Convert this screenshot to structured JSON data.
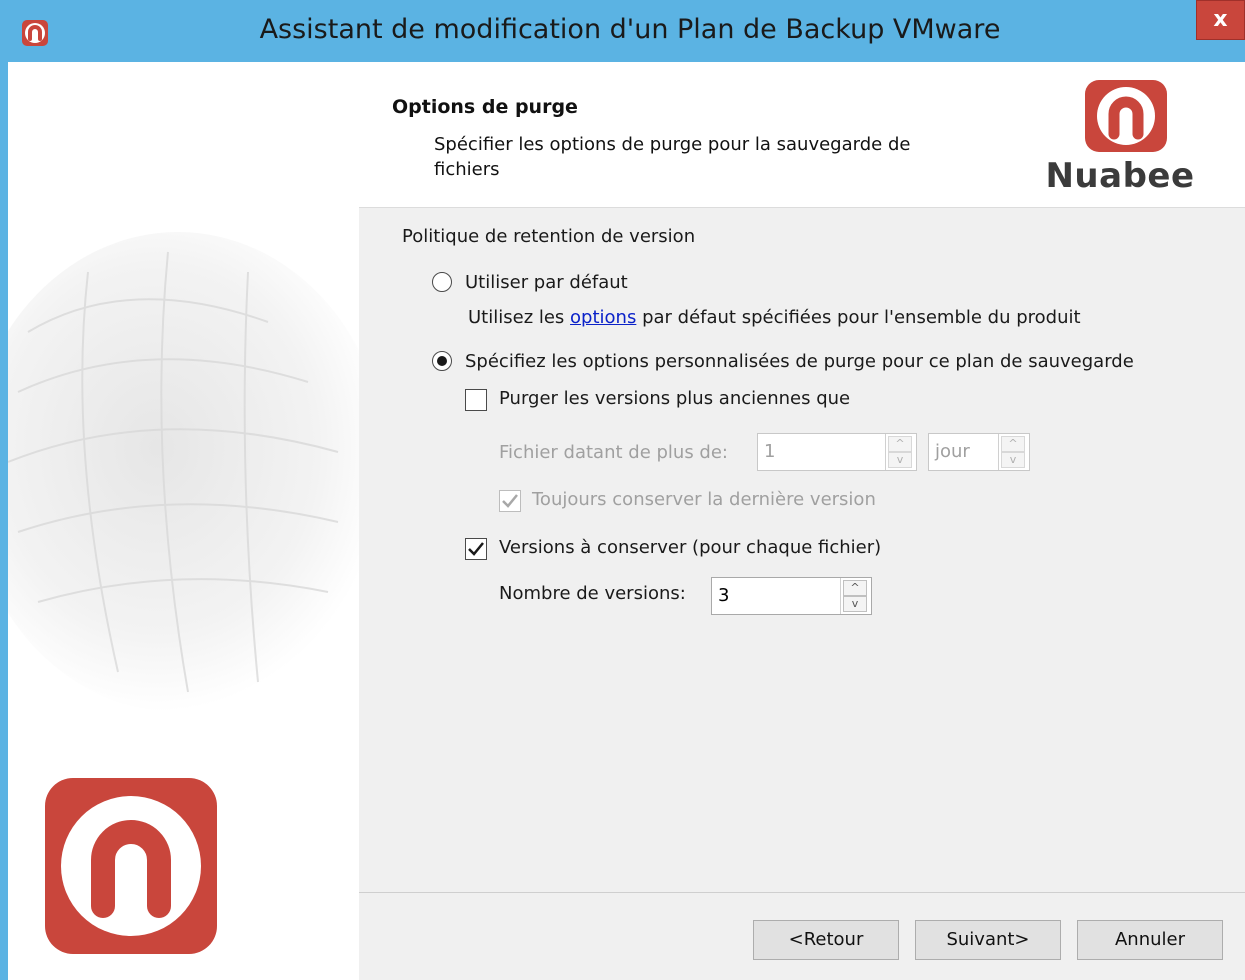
{
  "window": {
    "title": "Assistant de modification d'un Plan de Backup VMware",
    "close_label": "x",
    "accent_color": "#5bb3e3",
    "brand_color": "#c9463c"
  },
  "header": {
    "title": "Options de purge",
    "description": "Spécifier les options de purge pour la sauvegarde de fichiers",
    "brand_name": "Nuabee"
  },
  "retention": {
    "group_label": "Politique de retention de version",
    "default_option": {
      "label": "Utiliser par défaut",
      "desc_prefix": "Utilisez les ",
      "desc_link": "options",
      "desc_suffix": " par défaut spécifiées pour l'ensemble du produit",
      "selected": false
    },
    "custom_option": {
      "label": "Spécifiez les options personnalisées de purge pour ce plan de sauvegarde",
      "selected": true
    },
    "purge_older": {
      "label": "Purger les versions plus anciennes que",
      "checked": false,
      "age_label": "Fichier datant de plus de:",
      "age_value": "1",
      "unit_value": "jour",
      "keep_last_label": "Toujours conserver la dernière version",
      "keep_last_checked": true
    },
    "versions_to_keep": {
      "label": "Versions à conserver (pour chaque fichier)",
      "checked": true,
      "count_label": "Nombre de versions:",
      "count_value": "3"
    }
  },
  "footer": {
    "back_label": "<Retour",
    "next_label": "Suivant>",
    "cancel_label": "Annuler"
  }
}
